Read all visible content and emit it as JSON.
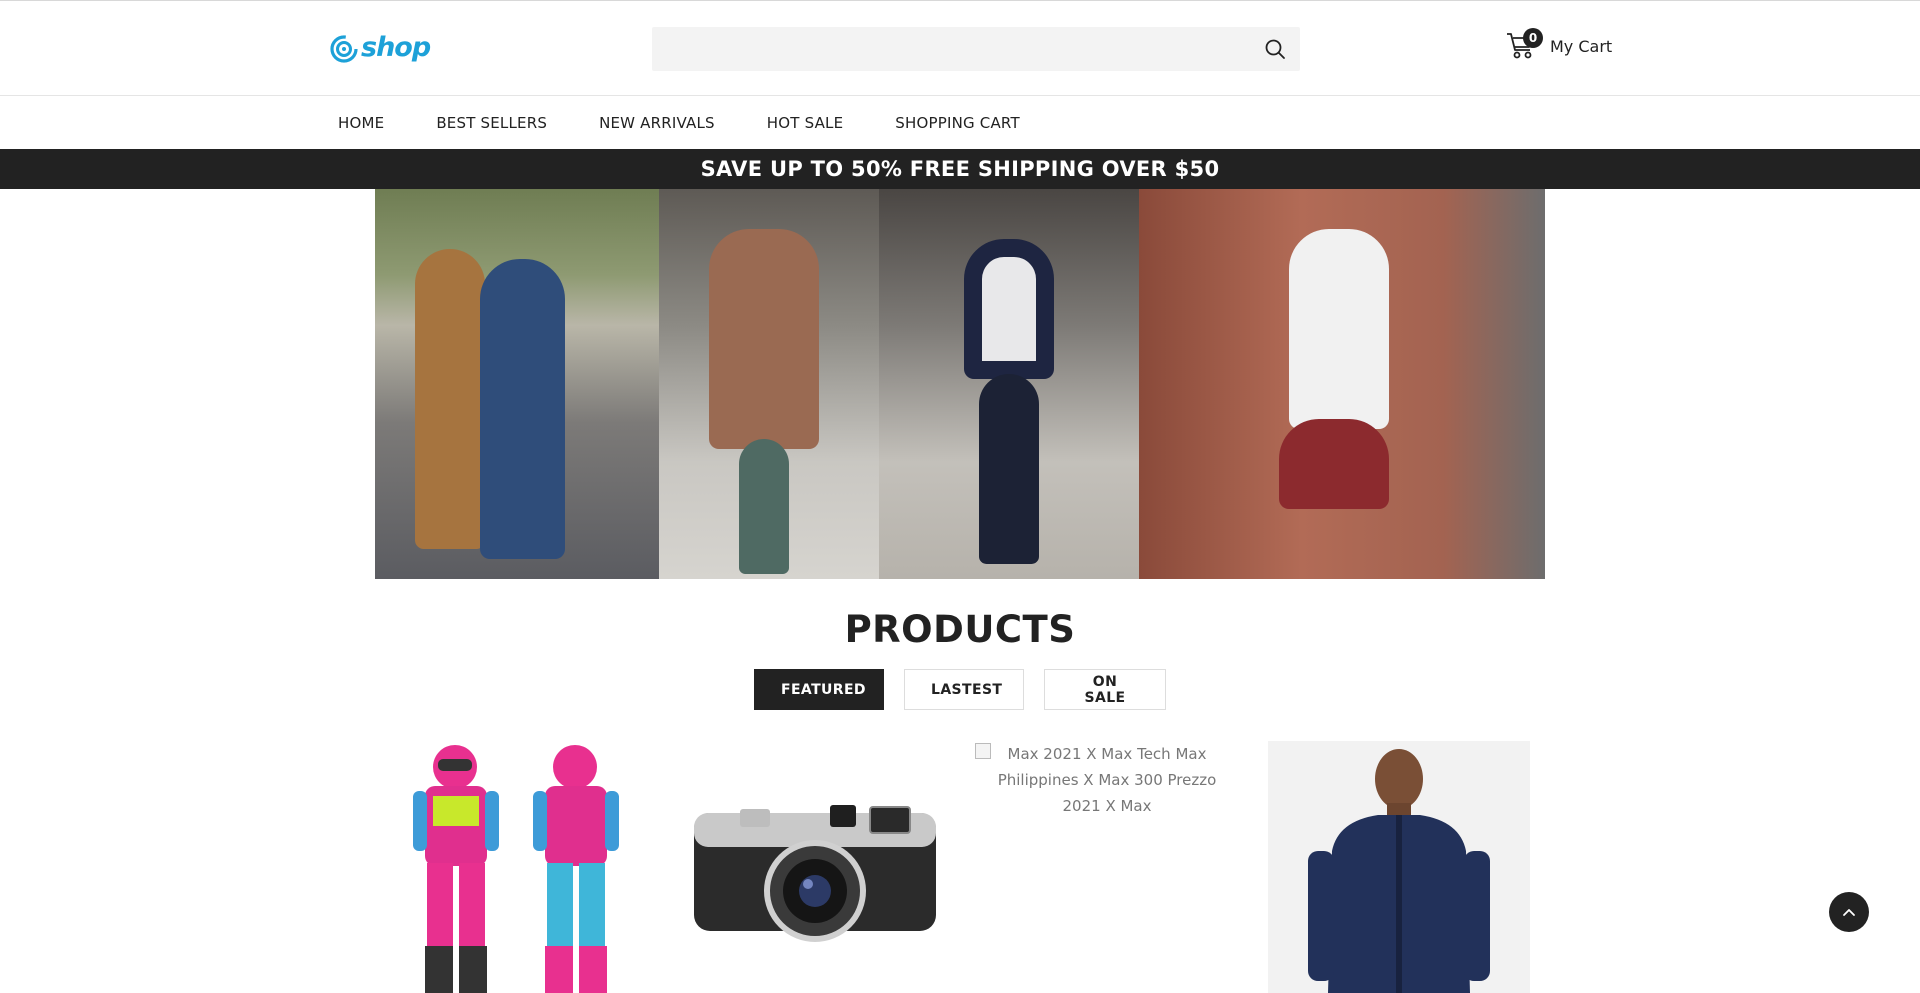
{
  "header": {
    "logo_text": "shop",
    "search": {
      "placeholder": "",
      "value": ""
    },
    "cart": {
      "count": "0",
      "label": "My Cart"
    }
  },
  "nav": {
    "items": [
      {
        "label": "HOME"
      },
      {
        "label": "BEST SELLERS"
      },
      {
        "label": "NEW ARRIVALS"
      },
      {
        "label": "HOT SALE"
      },
      {
        "label": "SHOPPING CART"
      }
    ]
  },
  "promo": {
    "text": "SAVE UP TO 50% FREE SHIPPING OVER $50"
  },
  "products": {
    "title": "PRODUCTS",
    "tabs": [
      {
        "label": "FEATURED",
        "active": true
      },
      {
        "label": "LASTEST",
        "active": false
      },
      {
        "label": "ON SALE",
        "active": false
      }
    ],
    "items": [
      {
        "image_icon": "motocross-gear-image"
      },
      {
        "image_icon": "leica-camera-image"
      },
      {
        "image_alt": "Max 2021 X Max Tech Max Philippines X Max 300 Prezzo 2021 X Max"
      },
      {
        "image_icon": "navy-jacket-image"
      }
    ]
  },
  "colors": {
    "accent": "#1da1d8",
    "dark": "#222222",
    "search_bg": "#f3f3f3"
  }
}
